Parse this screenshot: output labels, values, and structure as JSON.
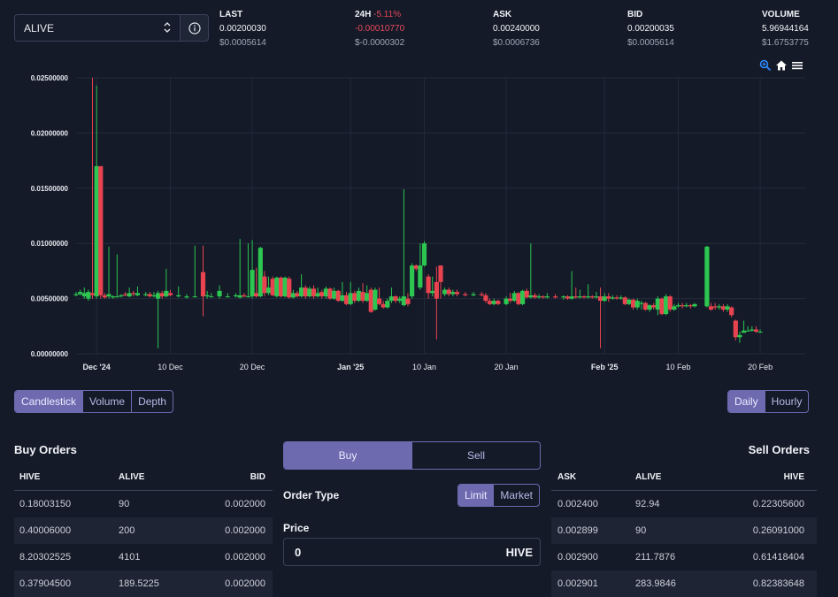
{
  "market": {
    "selected_token": "ALIVE"
  },
  "stats": {
    "last": {
      "label": "LAST",
      "value": "0.00200030",
      "usd": "$0.0005614"
    },
    "change": {
      "label": "24H",
      "pct": "-5.11%",
      "value": "-0.00010770",
      "usd": "$-0.0000302"
    },
    "ask": {
      "label": "ASK",
      "value": "0.00240000",
      "usd": "$0.0006736"
    },
    "bid": {
      "label": "BID",
      "value": "0.00200035",
      "usd": "$0.0005614"
    },
    "volume": {
      "label": "VOLUME",
      "value": "5.96944164",
      "usd": "$1.6753775"
    }
  },
  "chart_data": {
    "type": "candlestick",
    "ylim": [
      0,
      0.025
    ],
    "y_ticks": [
      "0.02500000",
      "0.02000000",
      "0.01500000",
      "0.01000000",
      "0.00500000",
      "0.00000000"
    ],
    "y_tick_values": [
      0.025,
      0.02,
      0.015,
      0.01,
      0.005,
      0
    ],
    "x_ticks": [
      {
        "label": "Dec '24",
        "day": 0,
        "bold": true
      },
      {
        "label": "10 Dec",
        "day": 9,
        "bold": false
      },
      {
        "label": "20 Dec",
        "day": 19,
        "bold": false
      },
      {
        "label": "Jan '25",
        "day": 31,
        "bold": true
      },
      {
        "label": "10 Jan",
        "day": 40,
        "bold": false
      },
      {
        "label": "20 Jan",
        "day": 50,
        "bold": false
      },
      {
        "label": "Feb '25",
        "day": 62,
        "bold": true
      },
      {
        "label": "10 Feb",
        "day": 71,
        "bold": false
      },
      {
        "label": "20 Feb",
        "day": 81,
        "bold": false
      }
    ],
    "xlim": [
      -2.5,
      86.5
    ],
    "candles": [
      [
        -3.5,
        0.0051,
        0.0052,
        0.006,
        0.005
      ],
      [
        -3.0,
        0.0052,
        0.0053,
        0.0055,
        0.005
      ],
      [
        -2.5,
        0.0053,
        0.0054,
        0.0056,
        0.0052
      ],
      [
        -2.0,
        0.0054,
        0.0056,
        0.0058,
        0.0053
      ],
      [
        -1.5,
        0.0052,
        0.0055,
        0.006,
        0.005
      ],
      [
        -1.0,
        0.005,
        0.0056,
        0.0058,
        0.0048
      ],
      [
        -0.5,
        0.0055,
        0.0053,
        0.025,
        0.005
      ],
      [
        0.0,
        0.0052,
        0.017,
        0.0243,
        0.005
      ],
      [
        0.5,
        0.017,
        0.0053,
        0.017,
        0.005
      ],
      [
        1.0,
        0.0053,
        0.0051,
        0.0055,
        0.005
      ],
      [
        1.5,
        0.0052,
        0.0054,
        0.0097,
        0.005
      ],
      [
        2.0,
        0.0051,
        0.0052,
        0.0053,
        0.005
      ],
      [
        2.5,
        0.0052,
        0.0052,
        0.009,
        0.0051
      ],
      [
        3.0,
        0.0052,
        0.0053,
        0.0054,
        0.0051
      ],
      [
        3.5,
        0.0054,
        0.0053,
        0.0056,
        0.0052
      ],
      [
        4.0,
        0.0052,
        0.0055,
        0.006,
        0.0051
      ],
      [
        4.5,
        0.0055,
        0.0054,
        0.0057,
        0.0052
      ],
      [
        5.0,
        0.0053,
        0.0055,
        0.0061,
        0.0052
      ],
      [
        6.0,
        0.0053,
        0.0054,
        0.0056,
        0.0052
      ],
      [
        6.5,
        0.0054,
        0.0052,
        0.0056,
        0.0051
      ],
      [
        7.0,
        0.0052,
        0.0053,
        0.0056,
        0.0051
      ],
      [
        7.5,
        0.005,
        0.0055,
        0.0057,
        0.0005
      ],
      [
        8.0,
        0.0055,
        0.0052,
        0.0057,
        0.005
      ],
      [
        8.5,
        0.0052,
        0.0057,
        0.0077,
        0.0051
      ],
      [
        9.0,
        0.0055,
        0.0053,
        0.0058,
        0.0052
      ],
      [
        10.0,
        0.0052,
        0.0053,
        0.0061,
        0.0051
      ],
      [
        11.0,
        0.0051,
        0.0052,
        0.0054,
        0.005
      ],
      [
        12.0,
        0.0052,
        0.0052,
        0.0098,
        0.0051
      ],
      [
        13.0,
        0.0074,
        0.0052,
        0.0098,
        0.0034
      ],
      [
        13.5,
        0.0052,
        0.0053,
        0.0057,
        0.005
      ],
      [
        14.0,
        0.0052,
        0.0052,
        0.0055,
        0.0051
      ],
      [
        15.0,
        0.0052,
        0.0057,
        0.0062,
        0.005
      ],
      [
        16.0,
        0.0052,
        0.0052,
        0.0055,
        0.0051
      ],
      [
        17.0,
        0.0052,
        0.0053,
        0.0055,
        0.0051
      ],
      [
        17.5,
        0.0051,
        0.0053,
        0.0104,
        0.005
      ],
      [
        18.0,
        0.0053,
        0.0052,
        0.0055,
        0.0051
      ],
      [
        18.5,
        0.0052,
        0.0052,
        0.01,
        0.0051
      ],
      [
        19.0,
        0.0052,
        0.0076,
        0.0103,
        0.005
      ],
      [
        19.5,
        0.0055,
        0.0052,
        0.0078,
        0.0051
      ],
      [
        20.0,
        0.0052,
        0.0096,
        0.0097,
        0.0051
      ],
      [
        20.5,
        0.007,
        0.0055,
        0.0075,
        0.0052
      ],
      [
        21.0,
        0.0055,
        0.006,
        0.007,
        0.0053
      ],
      [
        21.5,
        0.0068,
        0.0053,
        0.007,
        0.0052
      ],
      [
        22.0,
        0.0052,
        0.0069,
        0.007,
        0.0051
      ],
      [
        22.5,
        0.0069,
        0.0052,
        0.007,
        0.0051
      ],
      [
        23.0,
        0.0052,
        0.0069,
        0.007,
        0.0051
      ],
      [
        23.5,
        0.0068,
        0.0051,
        0.007,
        0.005
      ],
      [
        24.0,
        0.0051,
        0.0055,
        0.0058,
        0.005
      ],
      [
        24.5,
        0.0055,
        0.0052,
        0.0057,
        0.0051
      ],
      [
        25.0,
        0.0052,
        0.006,
        0.0072,
        0.0051
      ],
      [
        25.5,
        0.006,
        0.0052,
        0.0062,
        0.005
      ],
      [
        26.0,
        0.0052,
        0.0059,
        0.0061,
        0.0051
      ],
      [
        26.5,
        0.0059,
        0.0052,
        0.0062,
        0.005
      ],
      [
        27.0,
        0.0052,
        0.0055,
        0.006,
        0.0051
      ],
      [
        27.5,
        0.0056,
        0.0052,
        0.0058,
        0.005
      ],
      [
        28.0,
        0.0052,
        0.0059,
        0.0061,
        0.005
      ],
      [
        28.5,
        0.0059,
        0.005,
        0.006,
        0.0049
      ],
      [
        29.0,
        0.005,
        0.0057,
        0.006,
        0.0049
      ],
      [
        29.5,
        0.0057,
        0.0048,
        0.0058,
        0.0047
      ],
      [
        30.0,
        0.0048,
        0.0053,
        0.0065,
        0.0047
      ],
      [
        30.5,
        0.0053,
        0.0045,
        0.0056,
        0.0044
      ],
      [
        31.0,
        0.0045,
        0.0055,
        0.0065,
        0.0044
      ],
      [
        31.5,
        0.0055,
        0.0048,
        0.0057,
        0.0046
      ],
      [
        32.0,
        0.0048,
        0.0057,
        0.006,
        0.0047
      ],
      [
        32.5,
        0.0056,
        0.0048,
        0.0064,
        0.0046
      ],
      [
        33.0,
        0.0048,
        0.0055,
        0.0062,
        0.0047
      ],
      [
        33.5,
        0.0058,
        0.0038,
        0.006,
        0.0037
      ],
      [
        34.0,
        0.004,
        0.0058,
        0.006,
        0.0039
      ],
      [
        34.5,
        0.005,
        0.0045,
        0.006,
        0.0044
      ],
      [
        35.0,
        0.0045,
        0.0042,
        0.0048,
        0.0041
      ],
      [
        35.5,
        0.0042,
        0.0048,
        0.005,
        0.0041
      ],
      [
        36.0,
        0.0048,
        0.0052,
        0.006,
        0.0046
      ],
      [
        36.5,
        0.0052,
        0.0048,
        0.0053,
        0.0046
      ],
      [
        37.0,
        0.0048,
        0.005,
        0.0052,
        0.0046
      ],
      [
        37.5,
        0.0044,
        0.0052,
        0.0149,
        0.0043
      ],
      [
        38.0,
        0.005,
        0.0045,
        0.0055,
        0.0043
      ],
      [
        38.5,
        0.0052,
        0.008,
        0.0082,
        0.005
      ],
      [
        39.0,
        0.008,
        0.0077,
        0.0081,
        0.0075
      ],
      [
        39.5,
        0.006,
        0.008,
        0.01,
        0.0058
      ],
      [
        40.0,
        0.008,
        0.01,
        0.0102,
        0.0079
      ],
      [
        40.5,
        0.007,
        0.0055,
        0.0072,
        0.005
      ],
      [
        41.0,
        0.0055,
        0.0057,
        0.007,
        0.0052
      ],
      [
        41.5,
        0.0065,
        0.005,
        0.0079,
        0.0013
      ],
      [
        42.0,
        0.008,
        0.0065,
        0.008,
        0.005
      ],
      [
        42.5,
        0.0054,
        0.0058,
        0.006,
        0.0052
      ],
      [
        43.0,
        0.0058,
        0.0054,
        0.006,
        0.0052
      ],
      [
        43.5,
        0.0054,
        0.0056,
        0.0058,
        0.0052
      ],
      [
        44.0,
        0.0056,
        0.0054,
        0.0058,
        0.0052
      ],
      [
        45.0,
        0.0054,
        0.0053,
        0.0056,
        0.0052
      ],
      [
        46.0,
        0.0053,
        0.0054,
        0.0056,
        0.0052
      ],
      [
        47.0,
        0.0054,
        0.0053,
        0.0056,
        0.0052
      ],
      [
        47.5,
        0.0053,
        0.0048,
        0.0055,
        0.0046
      ],
      [
        48.0,
        0.0048,
        0.0045,
        0.005,
        0.0044
      ],
      [
        48.5,
        0.0045,
        0.0048,
        0.005,
        0.0044
      ],
      [
        49.0,
        0.0048,
        0.0045,
        0.0049,
        0.0044
      ],
      [
        50.0,
        0.0045,
        0.005,
        0.0052,
        0.0044
      ],
      [
        50.5,
        0.005,
        0.0048,
        0.0055,
        0.0046
      ],
      [
        51.0,
        0.0048,
        0.0055,
        0.0057,
        0.0047
      ],
      [
        51.5,
        0.0055,
        0.0045,
        0.0056,
        0.0044
      ],
      [
        52.0,
        0.0045,
        0.0057,
        0.0058,
        0.0044
      ],
      [
        52.5,
        0.0057,
        0.0051,
        0.0059,
        0.005
      ],
      [
        53.0,
        0.0051,
        0.0053,
        0.01,
        0.005
      ],
      [
        53.5,
        0.0053,
        0.0051,
        0.0055,
        0.005
      ],
      [
        54.0,
        0.0051,
        0.0052,
        0.0054,
        0.005
      ],
      [
        54.5,
        0.0052,
        0.0051,
        0.0053,
        0.005
      ],
      [
        55.0,
        0.0051,
        0.0052,
        0.0055,
        0.005
      ],
      [
        56.0,
        0.0052,
        0.0051,
        0.0054,
        0.005
      ],
      [
        57.0,
        0.0051,
        0.0052,
        0.0053,
        0.0049
      ],
      [
        57.5,
        0.0052,
        0.005,
        0.0053,
        0.0049
      ],
      [
        58.0,
        0.005,
        0.0052,
        0.0075,
        0.0049
      ],
      [
        58.5,
        0.0052,
        0.0051,
        0.006,
        0.005
      ],
      [
        59.0,
        0.0051,
        0.0052,
        0.0058,
        0.005
      ],
      [
        59.5,
        0.0052,
        0.0051,
        0.0053,
        0.005
      ],
      [
        60.0,
        0.0051,
        0.0052,
        0.0063,
        0.005
      ],
      [
        60.5,
        0.0052,
        0.0051,
        0.0053,
        0.005
      ],
      [
        61.0,
        0.0051,
        0.0052,
        0.0056,
        0.005
      ],
      [
        61.5,
        0.0052,
        0.0048,
        0.006,
        0.0005
      ],
      [
        62.0,
        0.0048,
        0.0052,
        0.0055,
        0.0047
      ],
      [
        62.5,
        0.0052,
        0.005,
        0.0055,
        0.0047
      ],
      [
        63.0,
        0.005,
        0.0051,
        0.0053,
        0.0049
      ],
      [
        63.5,
        0.0051,
        0.005,
        0.0053,
        0.0049
      ],
      [
        64.0,
        0.005,
        0.0051,
        0.0053,
        0.0049
      ],
      [
        64.5,
        0.0051,
        0.0045,
        0.0052,
        0.0044
      ],
      [
        65.0,
        0.0045,
        0.0049,
        0.005,
        0.0044
      ],
      [
        65.5,
        0.0049,
        0.0042,
        0.005,
        0.004
      ],
      [
        66.0,
        0.0042,
        0.0048,
        0.005,
        0.004
      ],
      [
        66.5,
        0.0045,
        0.0046,
        0.0048,
        0.004
      ],
      [
        67.0,
        0.0046,
        0.004,
        0.0047,
        0.0039
      ],
      [
        67.5,
        0.004,
        0.0044,
        0.0045,
        0.0038
      ],
      [
        68.0,
        0.0044,
        0.0042,
        0.0046,
        0.004
      ],
      [
        68.5,
        0.004,
        0.005,
        0.0052,
        0.0035
      ],
      [
        69.0,
        0.005,
        0.0036,
        0.0051,
        0.0035
      ],
      [
        69.5,
        0.0036,
        0.0052,
        0.0054,
        0.0035
      ],
      [
        70.0,
        0.0052,
        0.004,
        0.0053,
        0.0038
      ],
      [
        70.5,
        0.004,
        0.0043,
        0.0045,
        0.0039
      ],
      [
        71.0,
        0.0043,
        0.0044,
        0.0046,
        0.0042
      ],
      [
        71.5,
        0.0044,
        0.0043,
        0.0046,
        0.0041
      ],
      [
        72.0,
        0.0043,
        0.0044,
        0.0046,
        0.0042
      ],
      [
        72.5,
        0.0044,
        0.0043,
        0.0045,
        0.0041
      ],
      [
        73.0,
        0.0043,
        0.0045,
        0.0046,
        0.0042
      ],
      [
        74.5,
        0.0043,
        0.0097,
        0.0098,
        0.0042
      ],
      [
        75.0,
        0.0043,
        0.004,
        0.0046,
        0.0039
      ],
      [
        75.5,
        0.0043,
        0.0042,
        0.0046,
        0.004
      ],
      [
        76.0,
        0.0042,
        0.0043,
        0.0045,
        0.004
      ],
      [
        76.5,
        0.0043,
        0.004,
        0.0045,
        0.0038
      ],
      [
        77.0,
        0.004,
        0.0043,
        0.0045,
        0.0038
      ],
      [
        77.5,
        0.0042,
        0.0035,
        0.0043,
        0.0033
      ],
      [
        78.0,
        0.003,
        0.0015,
        0.0031,
        0.0012
      ],
      [
        78.5,
        0.0015,
        0.0017,
        0.002,
        0.001
      ],
      [
        79.0,
        0.0019,
        0.0021,
        0.003,
        0.0019
      ],
      [
        79.5,
        0.0021,
        0.0021,
        0.0025,
        0.002
      ],
      [
        80.0,
        0.0021,
        0.0022,
        0.0025,
        0.002
      ],
      [
        80.5,
        0.0022,
        0.002,
        0.0025,
        0.0019
      ],
      [
        81.0,
        0.002,
        0.002,
        0.0022,
        0.0019
      ]
    ],
    "colors": {
      "up": "#2cc650",
      "down": "#e8434f",
      "grid": "#232a3a"
    }
  },
  "chart_tools": {
    "zoom_icon": "magnifier-icon",
    "home_icon": "home-icon",
    "menu_icon": "menu-icon"
  },
  "chart_types": {
    "candlestick": "Candlestick",
    "volume": "Volume",
    "depth": "Depth"
  },
  "intervals": {
    "daily": "Daily",
    "hourly": "Hourly"
  },
  "buy_orders": {
    "title": "Buy Orders",
    "headers": [
      "HIVE",
      "ALIVE",
      "BID"
    ],
    "rows": [
      [
        "0.18003150",
        "90",
        "0.002000"
      ],
      [
        "0.40006000",
        "200",
        "0.002000"
      ],
      [
        "8.20302525",
        "4101",
        "0.002000"
      ],
      [
        "0.37904500",
        "189.5225",
        "0.002000"
      ]
    ]
  },
  "sell_orders": {
    "title": "Sell Orders",
    "headers": [
      "ASK",
      "ALIVE",
      "HIVE"
    ],
    "rows": [
      [
        "0.002400",
        "92.94",
        "0.22305600"
      ],
      [
        "0.002899",
        "90",
        "0.26091000"
      ],
      [
        "0.002900",
        "211.7876",
        "0.61418404"
      ],
      [
        "0.002901",
        "283.9846",
        "0.82383648"
      ]
    ]
  },
  "trade_form": {
    "buy_tab": "Buy",
    "sell_tab": "Sell",
    "order_type_label": "Order Type",
    "limit": "Limit",
    "market": "Market",
    "price_label": "Price",
    "price_value": "0",
    "price_currency": "HIVE"
  }
}
